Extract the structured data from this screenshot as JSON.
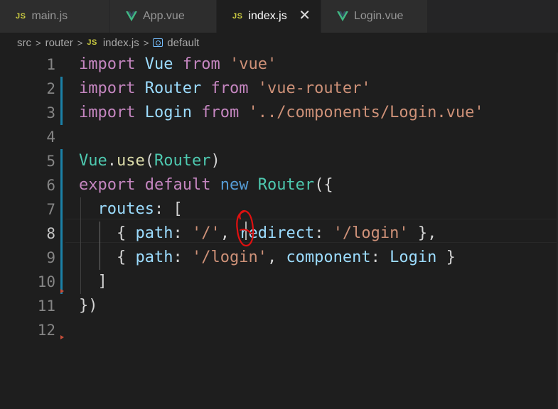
{
  "tabs": [
    {
      "label": "main.js",
      "icon": "js-file-icon",
      "icon_text": "JS",
      "active": false
    },
    {
      "label": "App.vue",
      "icon": "vue-file-icon",
      "active": false
    },
    {
      "label": "index.js",
      "icon": "js-file-icon",
      "icon_text": "JS",
      "active": true,
      "close": "✕"
    },
    {
      "label": "Login.vue",
      "icon": "vue-file-icon",
      "active": false
    }
  ],
  "breadcrumb": {
    "items": [
      "src",
      "router",
      "index.js",
      "default"
    ],
    "separator": ">",
    "file_icon_text": "JS"
  },
  "editor": {
    "current_line": 8,
    "lines": [
      {
        "n": "1",
        "tokens": [
          [
            "kw",
            "import"
          ],
          [
            "pun",
            " "
          ],
          [
            "id",
            "Vue"
          ],
          [
            "pun",
            " "
          ],
          [
            "kw",
            "from"
          ],
          [
            "pun",
            " "
          ],
          [
            "str",
            "'vue'"
          ]
        ]
      },
      {
        "n": "2",
        "tokens": [
          [
            "kw",
            "import"
          ],
          [
            "pun",
            " "
          ],
          [
            "id",
            "Router"
          ],
          [
            "pun",
            " "
          ],
          [
            "kw",
            "from"
          ],
          [
            "pun",
            " "
          ],
          [
            "str",
            "'vue-router'"
          ]
        ]
      },
      {
        "n": "3",
        "tokens": [
          [
            "kw",
            "import"
          ],
          [
            "pun",
            " "
          ],
          [
            "id",
            "Login"
          ],
          [
            "pun",
            " "
          ],
          [
            "kw",
            "from"
          ],
          [
            "pun",
            " "
          ],
          [
            "str",
            "'../components/Login.vue'"
          ]
        ]
      },
      {
        "n": "4",
        "tokens": []
      },
      {
        "n": "5",
        "tokens": [
          [
            "cls",
            "Vue"
          ],
          [
            "pun",
            "."
          ],
          [
            "fn",
            "use"
          ],
          [
            "pun",
            "("
          ],
          [
            "cls",
            "Router"
          ],
          [
            "pun",
            ")"
          ]
        ]
      },
      {
        "n": "6",
        "tokens": [
          [
            "kw",
            "export"
          ],
          [
            "pun",
            " "
          ],
          [
            "kw",
            "default"
          ],
          [
            "pun",
            " "
          ],
          [
            "kwb",
            "new"
          ],
          [
            "pun",
            " "
          ],
          [
            "cls",
            "Router"
          ],
          [
            "pun",
            "({"
          ]
        ]
      },
      {
        "n": "7",
        "tokens": [
          [
            "pun",
            "  "
          ],
          [
            "id",
            "routes"
          ],
          [
            "pun",
            ": ["
          ]
        ]
      },
      {
        "n": "8",
        "tokens": [
          [
            "pun",
            "    { "
          ],
          [
            "id",
            "path"
          ],
          [
            "pun",
            ": "
          ],
          [
            "str",
            "'/'"
          ],
          [
            "pun",
            ", "
          ],
          [
            "id",
            "redirect"
          ],
          [
            "pun",
            ": "
          ],
          [
            "str",
            "'/login'"
          ],
          [
            "pun",
            " },"
          ]
        ]
      },
      {
        "n": "9",
        "tokens": [
          [
            "pun",
            "    { "
          ],
          [
            "id",
            "path"
          ],
          [
            "pun",
            ": "
          ],
          [
            "str",
            "'/login'"
          ],
          [
            "pun",
            ", "
          ],
          [
            "id",
            "component"
          ],
          [
            "pun",
            ": "
          ],
          [
            "id",
            "Login"
          ],
          [
            "pun",
            " }"
          ]
        ]
      },
      {
        "n": "10",
        "tokens": [
          [
            "pun",
            "  ]"
          ]
        ]
      },
      {
        "n": "11",
        "tokens": [
          [
            "pun",
            "})"
          ]
        ]
      },
      {
        "n": "12",
        "tokens": []
      }
    ]
  },
  "colors": {
    "keyword": "#c586c0",
    "identifier": "#9cdcfe",
    "class": "#4ec9b0",
    "string": "#ce9178",
    "git_modified": "#1b81a8",
    "annotation": "#e01010"
  },
  "annotation": {
    "icon": "red-circle-annotation"
  }
}
